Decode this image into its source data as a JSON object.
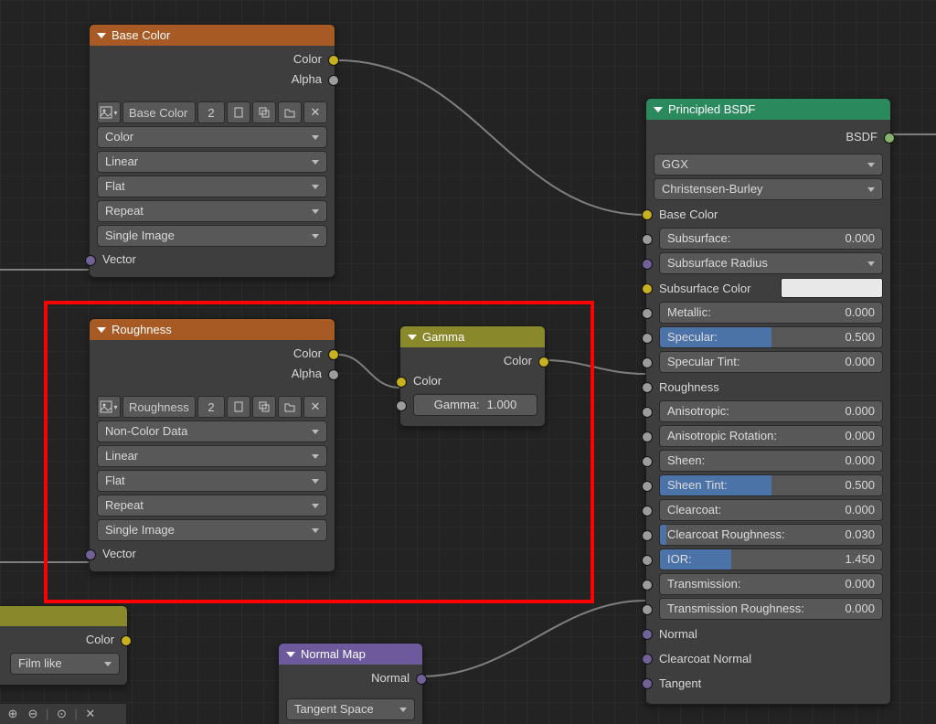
{
  "nodes": {
    "baseColor": {
      "title": "Base Color",
      "outputs": [
        "Color",
        "Alpha"
      ],
      "imageName": "Base Color",
      "imageUsers": "2",
      "selects": [
        "Color",
        "Linear",
        "Flat",
        "Repeat",
        "Single Image"
      ],
      "inputs": [
        "Vector"
      ]
    },
    "roughness": {
      "title": "Roughness",
      "outputs": [
        "Color",
        "Alpha"
      ],
      "imageName": "Roughness",
      "imageUsers": "2",
      "selects": [
        "Non-Color Data",
        "Linear",
        "Flat",
        "Repeat",
        "Single Image"
      ],
      "inputs": [
        "Vector"
      ]
    },
    "gamma": {
      "title": "Gamma",
      "output": "Color",
      "inputColor": "Color",
      "gammaLabel": "Gamma:",
      "gammaValue": "1.000"
    },
    "normalMap": {
      "title": "Normal Map",
      "output": "Normal",
      "select": "Tangent Space"
    },
    "principled": {
      "title": "Principled BSDF",
      "output": "BSDF",
      "selects": [
        "GGX",
        "Christensen-Burley"
      ],
      "rows": [
        {
          "k": "baseColor",
          "type": "label",
          "label": "Base Color",
          "sock": "yellow"
        },
        {
          "k": "subsurf",
          "type": "num",
          "label": "Subsurface:",
          "val": "0.000",
          "sock": "grey"
        },
        {
          "k": "subsurfRadius",
          "type": "select",
          "label": "Subsurface Radius",
          "sock": "purple"
        },
        {
          "k": "subsurfColor",
          "type": "swatch",
          "label": "Subsurface Color",
          "sock": "yellow"
        },
        {
          "k": "metallic",
          "type": "num",
          "label": "Metallic:",
          "val": "0.000",
          "sock": "grey"
        },
        {
          "k": "specular",
          "type": "num",
          "label": "Specular:",
          "val": "0.500",
          "sock": "grey",
          "fill": "f50"
        },
        {
          "k": "specTint",
          "type": "num",
          "label": "Specular Tint:",
          "val": "0.000",
          "sock": "grey"
        },
        {
          "k": "roughness",
          "type": "label",
          "label": "Roughness",
          "sock": "grey"
        },
        {
          "k": "aniso",
          "type": "num",
          "label": "Anisotropic:",
          "val": "0.000",
          "sock": "grey"
        },
        {
          "k": "anisoRot",
          "type": "num",
          "label": "Anisotropic Rotation:",
          "val": "0.000",
          "sock": "grey"
        },
        {
          "k": "sheen",
          "type": "num",
          "label": "Sheen:",
          "val": "0.000",
          "sock": "grey"
        },
        {
          "k": "sheenTint",
          "type": "num",
          "label": "Sheen Tint:",
          "val": "0.500",
          "sock": "grey",
          "fill": "f50"
        },
        {
          "k": "clearcoat",
          "type": "num",
          "label": "Clearcoat:",
          "val": "0.000",
          "sock": "grey"
        },
        {
          "k": "ccRough",
          "type": "num",
          "label": "Clearcoat Roughness:",
          "val": "0.030",
          "sock": "grey",
          "fill": "f3"
        },
        {
          "k": "ior",
          "type": "num",
          "label": "IOR:",
          "val": "1.450",
          "sock": "grey",
          "fill": "f32"
        },
        {
          "k": "trans",
          "type": "num",
          "label": "Transmission:",
          "val": "0.000",
          "sock": "grey"
        },
        {
          "k": "transRough",
          "type": "num",
          "label": "Transmission Roughness:",
          "val": "0.000",
          "sock": "grey"
        },
        {
          "k": "normal",
          "type": "label",
          "label": "Normal",
          "sock": "purple"
        },
        {
          "k": "ccNormal",
          "type": "label",
          "label": "Clearcoat Normal",
          "sock": "purple"
        },
        {
          "k": "tangent",
          "type": "label",
          "label": "Tangent",
          "sock": "purple"
        }
      ]
    },
    "partialLeft": {
      "output": "Color",
      "select": "Film like"
    }
  },
  "iconbar": [
    "⊕",
    "⊖",
    "⊙",
    "⊘",
    "✕"
  ]
}
